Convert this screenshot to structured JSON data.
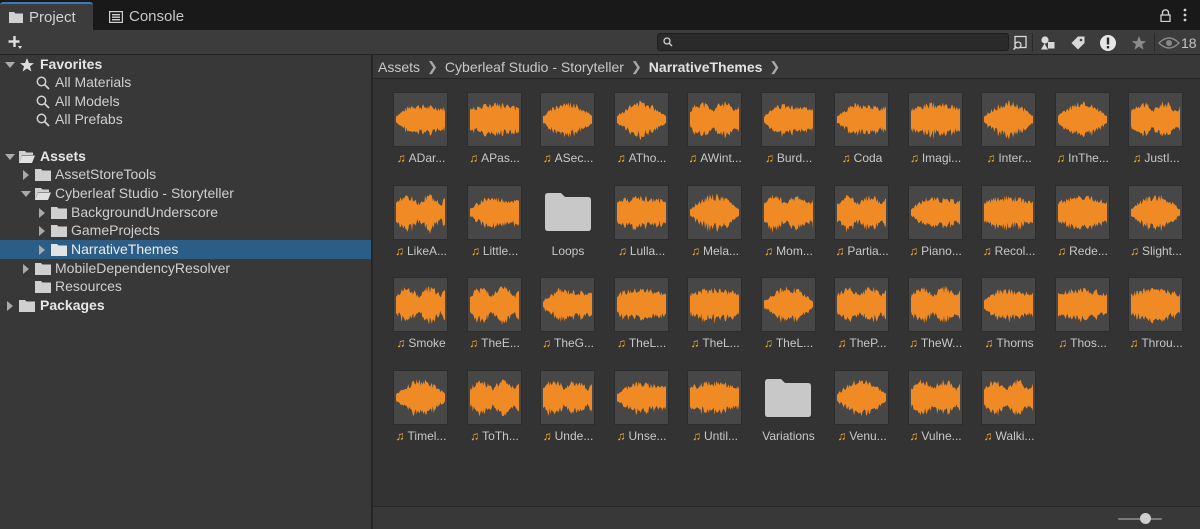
{
  "tabs": [
    {
      "label": "Project",
      "icon": "folder-icon",
      "active": true
    },
    {
      "label": "Console",
      "icon": "console-icon",
      "active": false
    }
  ],
  "toolbar": {
    "add_label": "+",
    "search_placeholder": "",
    "visible_count": "18",
    "accent": "#3a79bb"
  },
  "favorites": {
    "title": "Favorites",
    "items": [
      "All Materials",
      "All Models",
      "All Prefabs"
    ]
  },
  "tree": {
    "assets": "Assets",
    "asset_store_tools": "AssetStoreTools",
    "cyberleaf": "Cyberleaf Studio - Storyteller",
    "background": "BackgroundUnderscore",
    "game_projects": "GameProjects",
    "narrative": "NarrativeThemes",
    "mobile": "MobileDependencyResolver",
    "resources": "Resources",
    "packages": "Packages"
  },
  "breadcrumb": [
    "Assets",
    "Cyberleaf Studio - Storyteller",
    "NarrativeThemes"
  ],
  "items": [
    {
      "label": "ADar...",
      "type": "audio"
    },
    {
      "label": "APas...",
      "type": "audio"
    },
    {
      "label": "ASec...",
      "type": "audio"
    },
    {
      "label": "ATho...",
      "type": "audio"
    },
    {
      "label": "AWint...",
      "type": "audio"
    },
    {
      "label": "Burd...",
      "type": "audio"
    },
    {
      "label": "Coda",
      "type": "audio"
    },
    {
      "label": "Imagi...",
      "type": "audio"
    },
    {
      "label": "Inter...",
      "type": "audio"
    },
    {
      "label": "InThe...",
      "type": "audio"
    },
    {
      "label": "JustI...",
      "type": "audio"
    },
    {
      "label": "LikeA...",
      "type": "audio"
    },
    {
      "label": "Little...",
      "type": "audio"
    },
    {
      "label": "Loops",
      "type": "folder"
    },
    {
      "label": "Lulla...",
      "type": "audio"
    },
    {
      "label": "Mela...",
      "type": "audio"
    },
    {
      "label": "Mom...",
      "type": "audio"
    },
    {
      "label": "Partia...",
      "type": "audio"
    },
    {
      "label": "Piano...",
      "type": "audio"
    },
    {
      "label": "Recol...",
      "type": "audio"
    },
    {
      "label": "Rede...",
      "type": "audio"
    },
    {
      "label": "Slight...",
      "type": "audio"
    },
    {
      "label": "Smoke",
      "type": "audio"
    },
    {
      "label": "TheE...",
      "type": "audio"
    },
    {
      "label": "TheG...",
      "type": "audio"
    },
    {
      "label": "TheL...",
      "type": "audio"
    },
    {
      "label": "TheL...",
      "type": "audio"
    },
    {
      "label": "TheL...",
      "type": "audio"
    },
    {
      "label": "TheP...",
      "type": "audio"
    },
    {
      "label": "TheW...",
      "type": "audio"
    },
    {
      "label": "Thorns",
      "type": "audio"
    },
    {
      "label": "Thos...",
      "type": "audio"
    },
    {
      "label": "Throu...",
      "type": "audio"
    },
    {
      "label": "Timel...",
      "type": "audio"
    },
    {
      "label": "ToTh...",
      "type": "audio"
    },
    {
      "label": "Unde...",
      "type": "audio"
    },
    {
      "label": "Unse...",
      "type": "audio"
    },
    {
      "label": "Until...",
      "type": "audio"
    },
    {
      "label": "Variations",
      "type": "folder"
    },
    {
      "label": "Venu...",
      "type": "audio"
    },
    {
      "label": "Vulne...",
      "type": "audio"
    },
    {
      "label": "Walki...",
      "type": "audio"
    }
  ],
  "colors": {
    "waveform": "#f08a24",
    "note_icon": "#f0b030",
    "selection": "#2c5d87"
  }
}
